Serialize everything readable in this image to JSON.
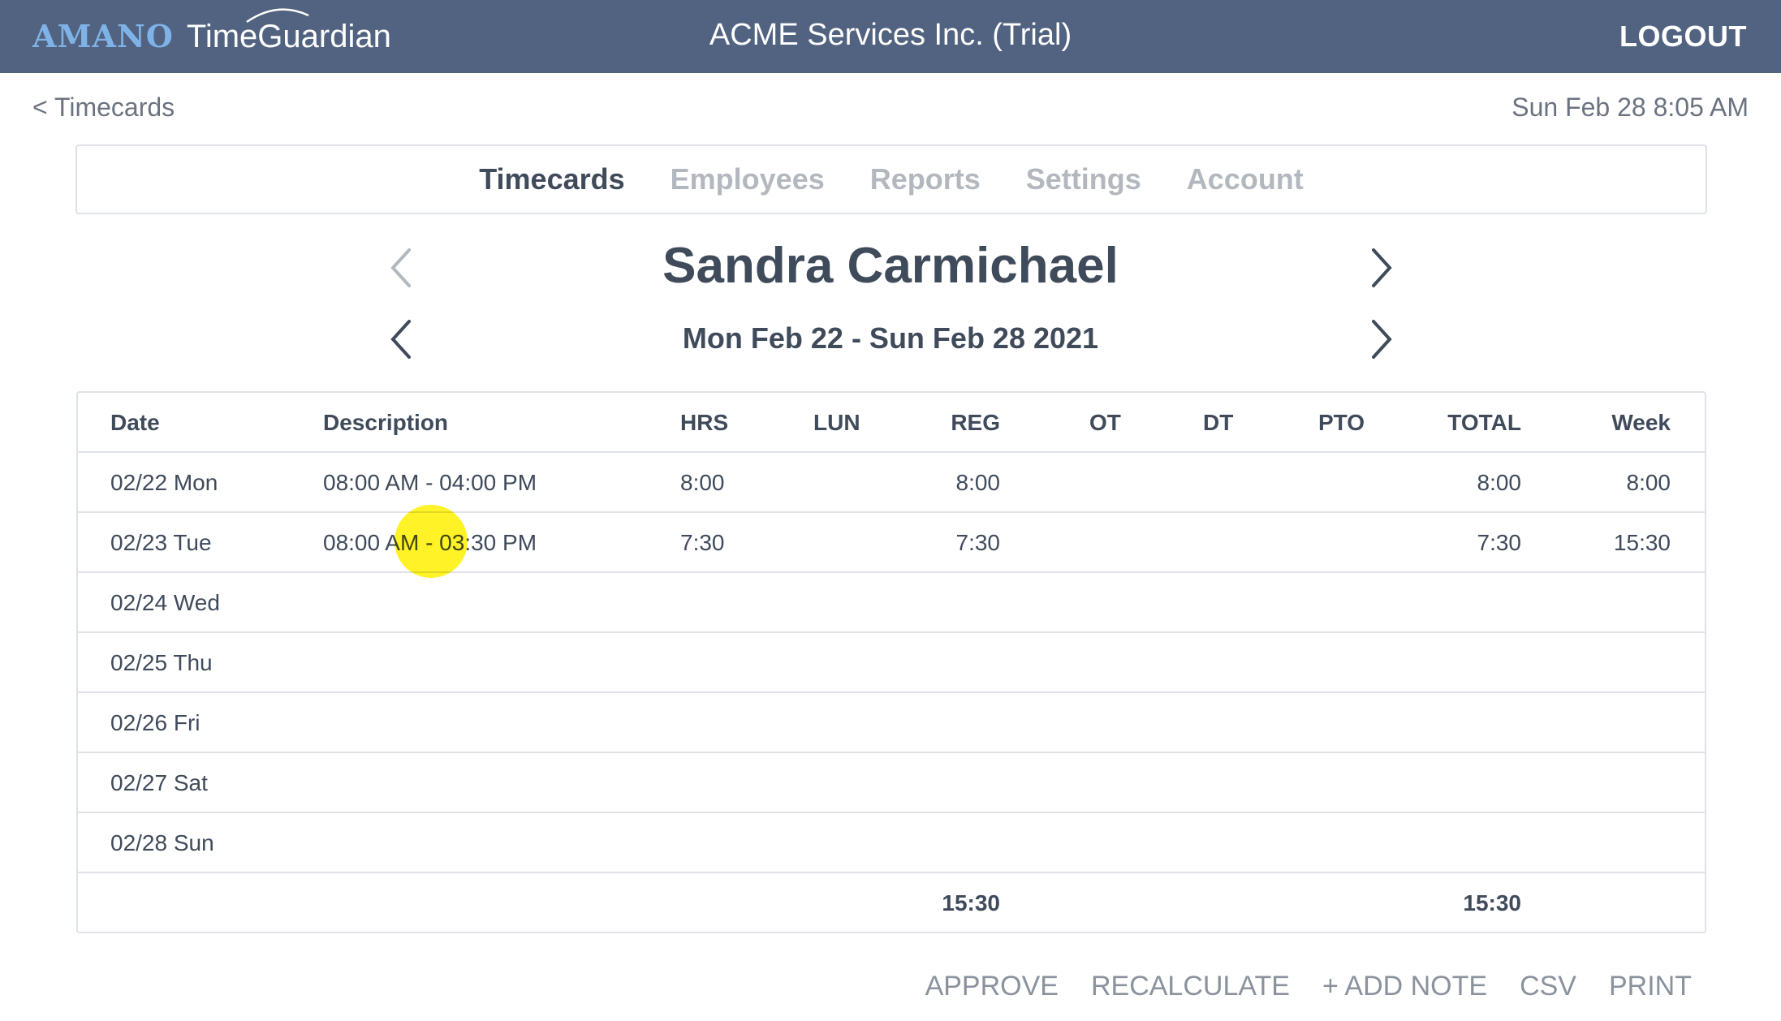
{
  "header": {
    "logo_brand": "AMANO",
    "logo_product": "TimeGuardian",
    "company": "ACME Services Inc. (Trial)",
    "logout_label": "LOGOUT"
  },
  "subheader": {
    "back_label": "< Timecards",
    "current_datetime": "Sun Feb 28 8:05 AM"
  },
  "nav": {
    "tabs": [
      {
        "label": "Timecards",
        "active": true
      },
      {
        "label": "Employees",
        "active": false
      },
      {
        "label": "Reports",
        "active": false
      },
      {
        "label": "Settings",
        "active": false
      },
      {
        "label": "Account",
        "active": false
      }
    ]
  },
  "employee": {
    "name": "Sandra Carmichael",
    "period": "Mon Feb 22 - Sun Feb 28 2021"
  },
  "table": {
    "columns": {
      "date": "Date",
      "description": "Description",
      "hrs": "HRS",
      "lun": "LUN",
      "reg": "REG",
      "ot": "OT",
      "dt": "DT",
      "pto": "PTO",
      "total": "TOTAL",
      "week": "Week"
    },
    "rows": [
      {
        "date": "02/22 Mon",
        "description": "08:00 AM - 04:00 PM",
        "hrs": "8:00",
        "lun": "",
        "reg": "8:00",
        "ot": "",
        "dt": "",
        "pto": "",
        "total": "8:00",
        "week": "8:00"
      },
      {
        "date": "02/23 Tue",
        "description": "08:00 AM - 03:30 PM",
        "hrs": "7:30",
        "lun": "",
        "reg": "7:30",
        "ot": "",
        "dt": "",
        "pto": "",
        "total": "7:30",
        "week": "15:30"
      },
      {
        "date": "02/24 Wed",
        "description": "",
        "hrs": "",
        "lun": "",
        "reg": "",
        "ot": "",
        "dt": "",
        "pto": "",
        "total": "",
        "week": ""
      },
      {
        "date": "02/25 Thu",
        "description": "",
        "hrs": "",
        "lun": "",
        "reg": "",
        "ot": "",
        "dt": "",
        "pto": "",
        "total": "",
        "week": ""
      },
      {
        "date": "02/26 Fri",
        "description": "",
        "hrs": "",
        "lun": "",
        "reg": "",
        "ot": "",
        "dt": "",
        "pto": "",
        "total": "",
        "week": ""
      },
      {
        "date": "02/27 Sat",
        "description": "",
        "hrs": "",
        "lun": "",
        "reg": "",
        "ot": "",
        "dt": "",
        "pto": "",
        "total": "",
        "week": ""
      },
      {
        "date": "02/28 Sun",
        "description": "",
        "hrs": "",
        "lun": "",
        "reg": "",
        "ot": "",
        "dt": "",
        "pto": "",
        "total": "",
        "week": ""
      }
    ],
    "totals": {
      "reg": "15:30",
      "total": "15:30"
    }
  },
  "actions": {
    "approve": "APPROVE",
    "recalculate": "RECALCULATE",
    "add_note": "+ ADD NOTE",
    "csv": "CSV",
    "print": "PRINT"
  },
  "icons": {
    "prev_employee": "chevron-left-icon",
    "next_employee": "chevron-right-icon",
    "prev_period": "chevron-left-icon",
    "next_period": "chevron-right-icon"
  },
  "colors": {
    "header_bg": "#516380",
    "brand_blue": "#7fb3e8",
    "text_dark": "#3f4a5a",
    "text_muted": "#b3b8bf",
    "border": "#dfe2e7",
    "click_marker": "#fff000"
  }
}
